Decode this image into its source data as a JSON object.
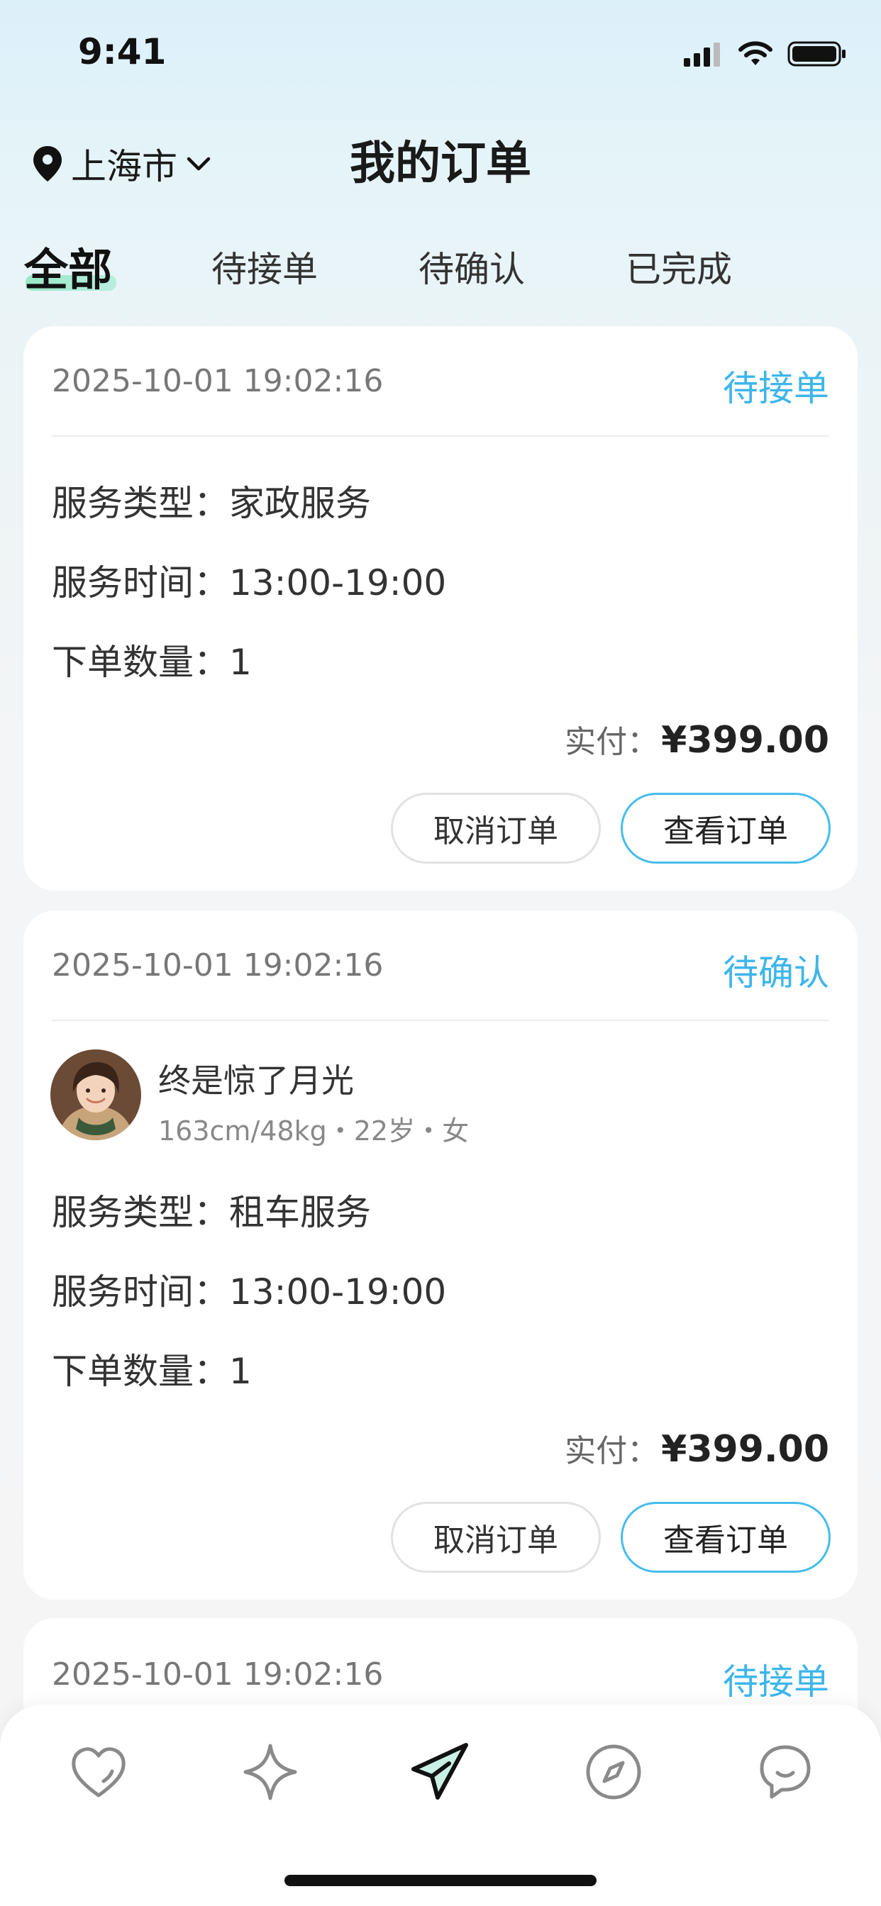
{
  "status_bar": {
    "time": "9:41"
  },
  "header": {
    "location": "上海市",
    "title": "我的订单"
  },
  "tabs": [
    {
      "label": "全部",
      "active": true
    },
    {
      "label": "待接单",
      "active": false
    },
    {
      "label": "待确认",
      "active": false
    },
    {
      "label": "已完成",
      "active": false
    }
  ],
  "orders": [
    {
      "time": "2025-10-01 19:02:16",
      "status": "待接单",
      "service_type_label": "服务类型：",
      "service_type": "家政服务",
      "service_time_label": "服务时间：",
      "service_time": "13:00-19:00",
      "quantity_label": "下单数量：",
      "quantity": "1",
      "paid_label": "实付：",
      "paid_amount": "¥399.00",
      "cancel_label": "取消订单",
      "view_label": "查看订单"
    },
    {
      "time": "2025-10-01 19:02:16",
      "status": "待确认",
      "user": {
        "name": "终是惊了月光",
        "meta": "163cm/48kg・22岁・女"
      },
      "service_type_label": "服务类型：",
      "service_type": "租车服务",
      "service_time_label": "服务时间：",
      "service_time": "13:00-19:00",
      "quantity_label": "下单数量：",
      "quantity": "1",
      "paid_label": "实付：",
      "paid_amount": "¥399.00",
      "cancel_label": "取消订单",
      "view_label": "查看订单"
    },
    {
      "time": "2025-10-01 19:02:16",
      "status": "待接单"
    }
  ],
  "bottom_nav": [
    {
      "icon": "heart-icon",
      "active": false
    },
    {
      "icon": "sparkle-icon",
      "active": false
    },
    {
      "icon": "paper-plane-icon",
      "active": true
    },
    {
      "icon": "compass-icon",
      "active": false
    },
    {
      "icon": "chat-bubble-icon",
      "active": false
    }
  ],
  "colors": {
    "accent": "#3db6ea",
    "tab_highlight": "#9ae7c6",
    "nav_active_fill": "#c9f0e4"
  }
}
